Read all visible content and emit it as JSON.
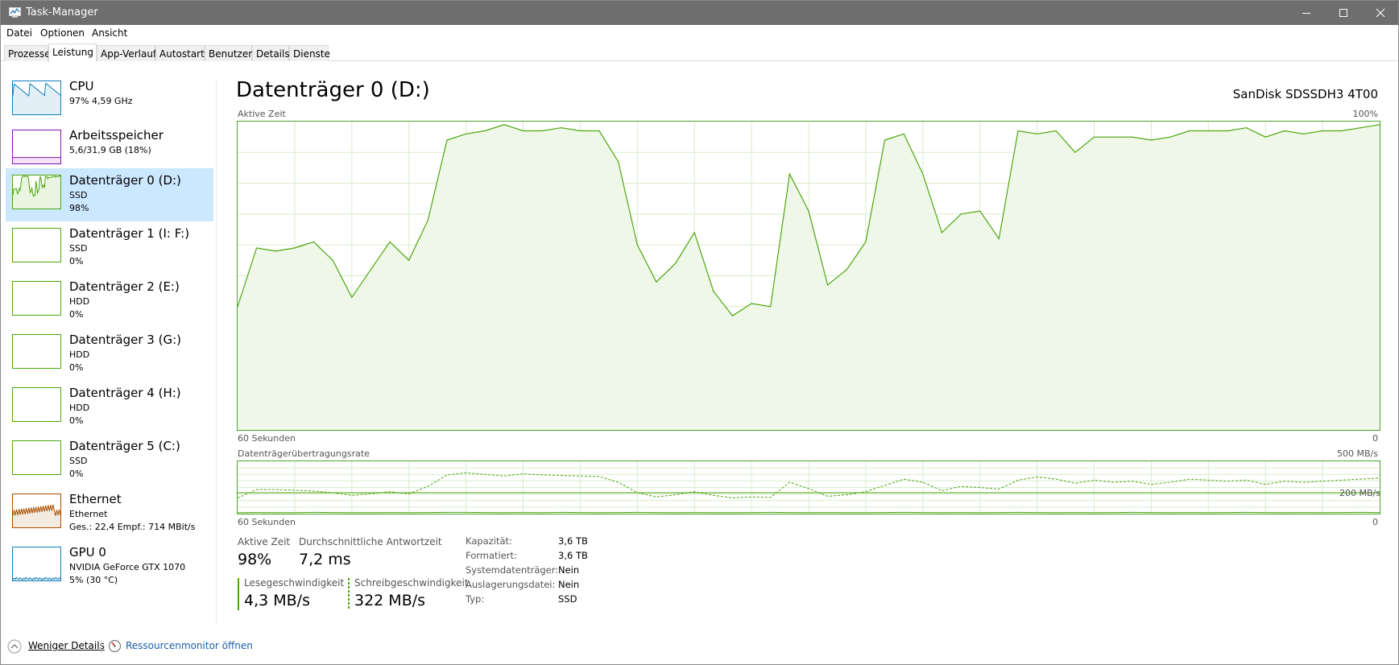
{
  "window": {
    "title": "Task-Manager"
  },
  "menu": [
    {
      "label": "Datei"
    },
    {
      "label": "Optionen"
    },
    {
      "label": "Ansicht"
    }
  ],
  "tabs": [
    {
      "label": "Prozesse"
    },
    {
      "label": "Leistung"
    },
    {
      "label": "App-Verlauf"
    },
    {
      "label": "Autostart"
    },
    {
      "label": "Benutzer"
    },
    {
      "label": "Details"
    },
    {
      "label": "Dienste"
    }
  ],
  "sidebar": [
    {
      "title": "CPU",
      "sub1": "97% 4,59 GHz",
      "sub2": "",
      "color": "#117dbb"
    },
    {
      "title": "Arbeitsspeicher",
      "sub1": "5,6/31,9 GB (18%)",
      "sub2": "",
      "color": "#8b12ae"
    },
    {
      "title": "Datenträger 0 (D:)",
      "sub1": "SSD",
      "sub2": "98%",
      "color": "#4da60c"
    },
    {
      "title": "Datenträger 1 (I: F:)",
      "sub1": "SSD",
      "sub2": "0%",
      "color": "#4da60c"
    },
    {
      "title": "Datenträger 2 (E:)",
      "sub1": "HDD",
      "sub2": "0%",
      "color": "#4da60c"
    },
    {
      "title": "Datenträger 3 (G:)",
      "sub1": "HDD",
      "sub2": "0%",
      "color": "#4da60c"
    },
    {
      "title": "Datenträger 4 (H:)",
      "sub1": "HDD",
      "sub2": "0%",
      "color": "#4da60c"
    },
    {
      "title": "Datenträger 5 (C:)",
      "sub1": "SSD",
      "sub2": "0%",
      "color": "#4da60c"
    },
    {
      "title": "Ethernet",
      "sub1": "Ethernet",
      "sub2": "Ges.: 22,4 Empf.: 714 MBit/s",
      "color": "#a74f01"
    },
    {
      "title": "GPU 0",
      "sub1": "NVIDIA GeForce GTX 1070",
      "sub2": "5% (30 °C)",
      "color": "#117dbb"
    }
  ],
  "main": {
    "title": "Datenträger 0 (D:)",
    "model": "SanDisk SDSSDH3 4T00"
  },
  "chart_data": [
    {
      "type": "area",
      "title": "Aktive Zeit",
      "xlabel": "60 Sekunden",
      "x_start_label": "60 Sekunden",
      "x_end_label": "0",
      "ymax_label": "100%",
      "ylim": [
        0,
        100
      ],
      "grid": true,
      "color": "#4da60c",
      "fill": "#eff7e9",
      "values": [
        40,
        59,
        58,
        59,
        61,
        55,
        43,
        52,
        61,
        55,
        68,
        94,
        96,
        97,
        99,
        97,
        97,
        98,
        97,
        97,
        87,
        60,
        48,
        54,
        64,
        45,
        37,
        41,
        40,
        83,
        71,
        47,
        52,
        61,
        94,
        96,
        83,
        64,
        70,
        71,
        62,
        97,
        96,
        97,
        90,
        95,
        95,
        95,
        94,
        95,
        97,
        97,
        97,
        98,
        95,
        97,
        96,
        97,
        97,
        98,
        99
      ]
    },
    {
      "type": "line",
      "title": "Datenträgerübertragungsrate",
      "x_start_label": "60 Sekunden",
      "x_end_label": "0",
      "ymax_label": "500 MB/s",
      "reference_label": "200 MB/s",
      "reference_value": 200,
      "ylim": [
        0,
        500
      ],
      "grid": true,
      "series": [
        {
          "name": "Lesegeschwindigkeit",
          "color": "#4da60c",
          "style": "solid",
          "values": [
            10,
            11,
            10,
            10,
            12,
            11,
            10,
            10,
            11,
            10,
            11,
            12,
            12,
            11,
            10,
            11,
            10,
            12,
            11,
            10,
            11,
            12,
            11,
            10,
            11,
            10,
            10,
            11,
            12,
            11,
            10,
            11,
            10,
            10,
            11,
            12,
            11,
            10,
            11,
            10,
            11,
            12,
            11,
            10,
            11,
            10,
            11,
            12,
            11,
            10,
            11,
            10,
            11,
            12,
            11,
            10,
            11,
            10,
            11,
            12,
            11
          ]
        },
        {
          "name": "Schreibgeschwindigkeit",
          "color": "#4da60c",
          "style": "dashed",
          "values": [
            150,
            230,
            230,
            225,
            215,
            200,
            175,
            190,
            210,
            190,
            260,
            370,
            390,
            375,
            360,
            380,
            370,
            365,
            360,
            355,
            300,
            200,
            160,
            180,
            210,
            175,
            150,
            160,
            155,
            300,
            240,
            165,
            180,
            210,
            270,
            330,
            300,
            220,
            260,
            250,
            235,
            320,
            350,
            330,
            290,
            320,
            300,
            310,
            280,
            300,
            330,
            320,
            310,
            320,
            280,
            310,
            300,
            310,
            320,
            330,
            340
          ]
        }
      ]
    }
  ],
  "stats": {
    "active_time": {
      "label": "Aktive Zeit",
      "value": "98%"
    },
    "avg_response": {
      "label": "Durchschnittliche Antwortzeit",
      "value": "7,2 ms"
    },
    "read": {
      "label": "Lesegeschwindigkeit",
      "value": "4,3 MB/s"
    },
    "write": {
      "label": "Schreibgeschwindigkeit",
      "value": "322 MB/s"
    }
  },
  "properties": [
    {
      "key": "Kapazität:",
      "value": "3,6 TB"
    },
    {
      "key": "Formatiert:",
      "value": "3,6 TB"
    },
    {
      "key": "Systemdatenträger:",
      "value": "Nein"
    },
    {
      "key": "Auslagerungsdatei:",
      "value": "Nein"
    },
    {
      "key": "Typ:",
      "value": "SSD"
    }
  ],
  "footer": {
    "fewer_details": "Weniger Details",
    "resource_monitor": "Ressourcenmonitor öffnen"
  }
}
